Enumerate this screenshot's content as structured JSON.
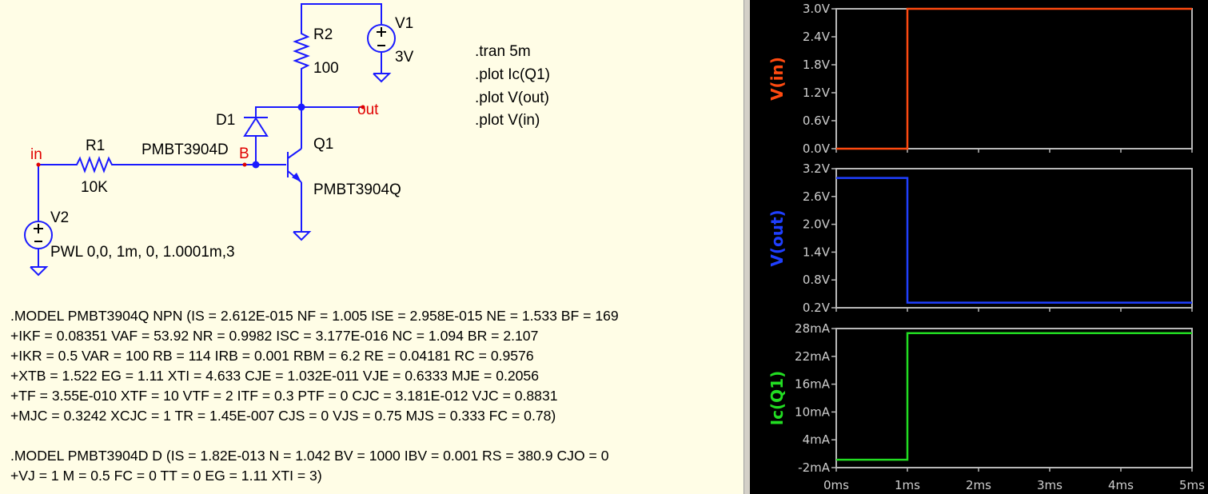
{
  "schematic": {
    "components": {
      "r1": {
        "name": "R1",
        "value": "10K"
      },
      "r2": {
        "name": "R2",
        "value": "100"
      },
      "v1": {
        "name": "V1",
        "value": "3V"
      },
      "v2": {
        "name": "V2",
        "value": "PWL 0,0, 1m, 0, 1.0001m,3"
      },
      "d1": {
        "name": "D1",
        "model": "PMBT3904D"
      },
      "q1": {
        "name": "Q1",
        "model": "PMBT3904Q"
      }
    },
    "nets": {
      "in": "in",
      "out": "out",
      "b": "B"
    },
    "directives": [
      ".tran 5m",
      ".plot Ic(Q1)",
      ".plot V(out)",
      ".plot V(in)"
    ],
    "models_q": [
      ".MODEL PMBT3904Q NPN (IS = 2.612E-015 NF = 1.005 ISE = 2.958E-015 NE = 1.533 BF = 169",
      "+IKF = 0.08351 VAF = 53.92 NR = 0.9982 ISC = 3.177E-016 NC = 1.094 BR = 2.107",
      "+IKR = 0.5 VAR = 100 RB = 114 IRB = 0.001 RBM = 6.2 RE = 0.04181 RC = 0.9576",
      "+XTB = 1.522 EG = 1.11 XTI = 4.633 CJE = 1.032E-011 VJE = 0.6333 MJE = 0.2056",
      "+TF = 3.55E-010 XTF = 10 VTF = 2 ITF = 0.3 PTF = 0 CJC = 3.181E-012 VJC = 0.8831",
      "+MJC = 0.3242 XCJC = 1 TR = 1.45E-007 CJS = 0 VJS = 0.75 MJS = 0.333 FC = 0.78)"
    ],
    "models_d": [
      ".MODEL PMBT3904D D (IS = 1.82E-013 N = 1.042 BV = 1000 IBV = 0.001 RS = 380.9 CJO = 0",
      "+VJ = 1 M = 0.5 FC = 0 TT = 0 EG = 1.11 XTI = 3)"
    ]
  },
  "chart_data": [
    {
      "type": "line",
      "ylabel": "V(in)",
      "color": "#ff4a10",
      "x_ticks": [
        "0ms",
        "1ms",
        "2ms",
        "3ms",
        "4ms",
        "5ms"
      ],
      "y_ticks": [
        "3.0V",
        "2.4V",
        "1.8V",
        "1.2V",
        "0.6V",
        "0.0V"
      ],
      "y_tick_values": [
        3.0,
        2.4,
        1.8,
        1.2,
        0.6,
        0.0
      ],
      "ylim": [
        0,
        3.0
      ],
      "xlim": [
        0,
        5
      ],
      "x": [
        0,
        1.0,
        1.0001,
        5
      ],
      "y": [
        0,
        0,
        3.0,
        3.0
      ]
    },
    {
      "type": "line",
      "ylabel": "V(out)",
      "color": "#1f3fff",
      "x_ticks": [
        "0ms",
        "1ms",
        "2ms",
        "3ms",
        "4ms",
        "5ms"
      ],
      "y_ticks": [
        "3.2V",
        "2.6V",
        "2.0V",
        "1.4V",
        "0.8V",
        "0.2V"
      ],
      "y_tick_values": [
        3.2,
        2.6,
        2.0,
        1.4,
        0.8,
        0.2
      ],
      "ylim": [
        0.2,
        3.2
      ],
      "xlim": [
        0,
        5
      ],
      "x": [
        0,
        1.0,
        1.0001,
        5
      ],
      "y": [
        3.0,
        3.0,
        0.31,
        0.31
      ]
    },
    {
      "type": "line",
      "ylabel": "Ic(Q1)",
      "color": "#22dd22",
      "x_ticks": [
        "0ms",
        "1ms",
        "2ms",
        "3ms",
        "4ms",
        "5ms"
      ],
      "y_ticks": [
        "28mA",
        "22mA",
        "16mA",
        "10mA",
        "4mA",
        "-2mA"
      ],
      "y_tick_values": [
        28,
        22,
        16,
        10,
        4,
        -2
      ],
      "ylim": [
        -2,
        28
      ],
      "xlim": [
        0,
        5
      ],
      "x": [
        0,
        1.0,
        1.0001,
        5
      ],
      "y": [
        -0.3,
        -0.3,
        27.0,
        27.0
      ]
    }
  ]
}
